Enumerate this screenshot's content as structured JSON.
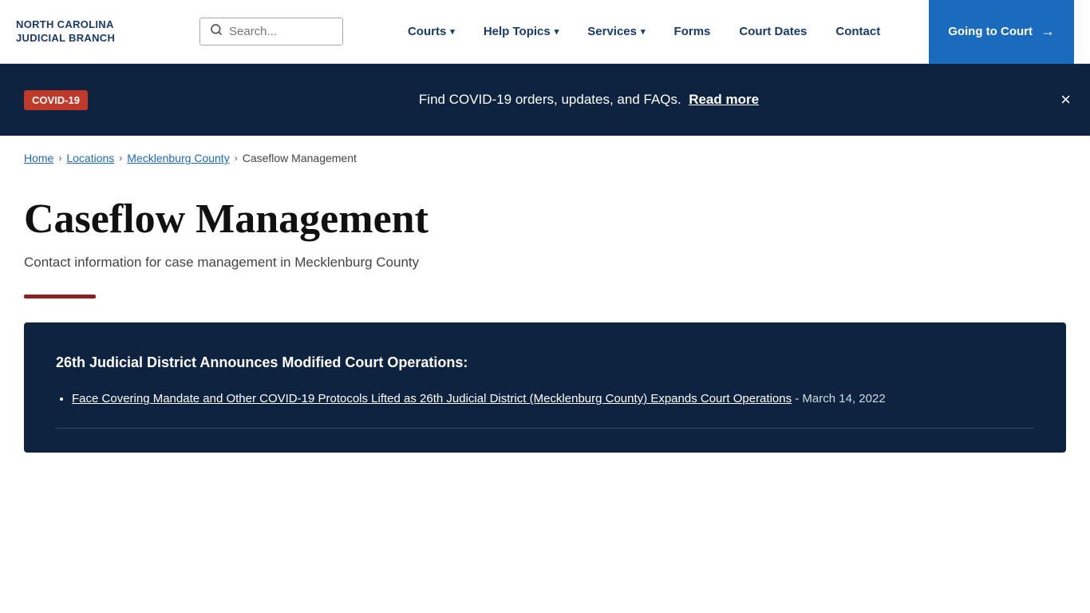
{
  "header": {
    "logo_line1": "NORTH CAROLINA",
    "logo_line2": "JUDICIAL BRANCH",
    "search_placeholder": "Search...",
    "nav": [
      {
        "id": "courts",
        "label": "Courts",
        "hasDropdown": true
      },
      {
        "id": "help-topics",
        "label": "Help Topics",
        "hasDropdown": true
      },
      {
        "id": "services",
        "label": "Services",
        "hasDropdown": true
      },
      {
        "id": "forms",
        "label": "Forms",
        "hasDropdown": false
      },
      {
        "id": "court-dates",
        "label": "Court Dates",
        "hasDropdown": false
      },
      {
        "id": "contact",
        "label": "Contact",
        "hasDropdown": false
      }
    ],
    "cta_label": "Going to Court",
    "cta_arrow": "→"
  },
  "covid_banner": {
    "badge": "COVID-19",
    "text": "Find COVID-19 orders, updates, and FAQs.",
    "link_text": "Read more",
    "close_label": "×"
  },
  "breadcrumb": {
    "items": [
      {
        "label": "Home",
        "link": true
      },
      {
        "label": "Locations",
        "link": true
      },
      {
        "label": "Mecklenburg County",
        "link": true
      },
      {
        "label": "Caseflow Management",
        "link": false
      }
    ]
  },
  "page": {
    "title": "Caseflow Management",
    "subtitle": "Contact information for case management in Mecklenburg County"
  },
  "info_box": {
    "title": "26th Judicial District Announces Modified Court Operations:",
    "items": [
      {
        "link_text": "Face Covering Mandate and Other COVID-19 Protocols Lifted as 26th Judicial District (Mecklenburg County) Expands Court Operations",
        "date": "- March 14, 2022"
      }
    ]
  }
}
